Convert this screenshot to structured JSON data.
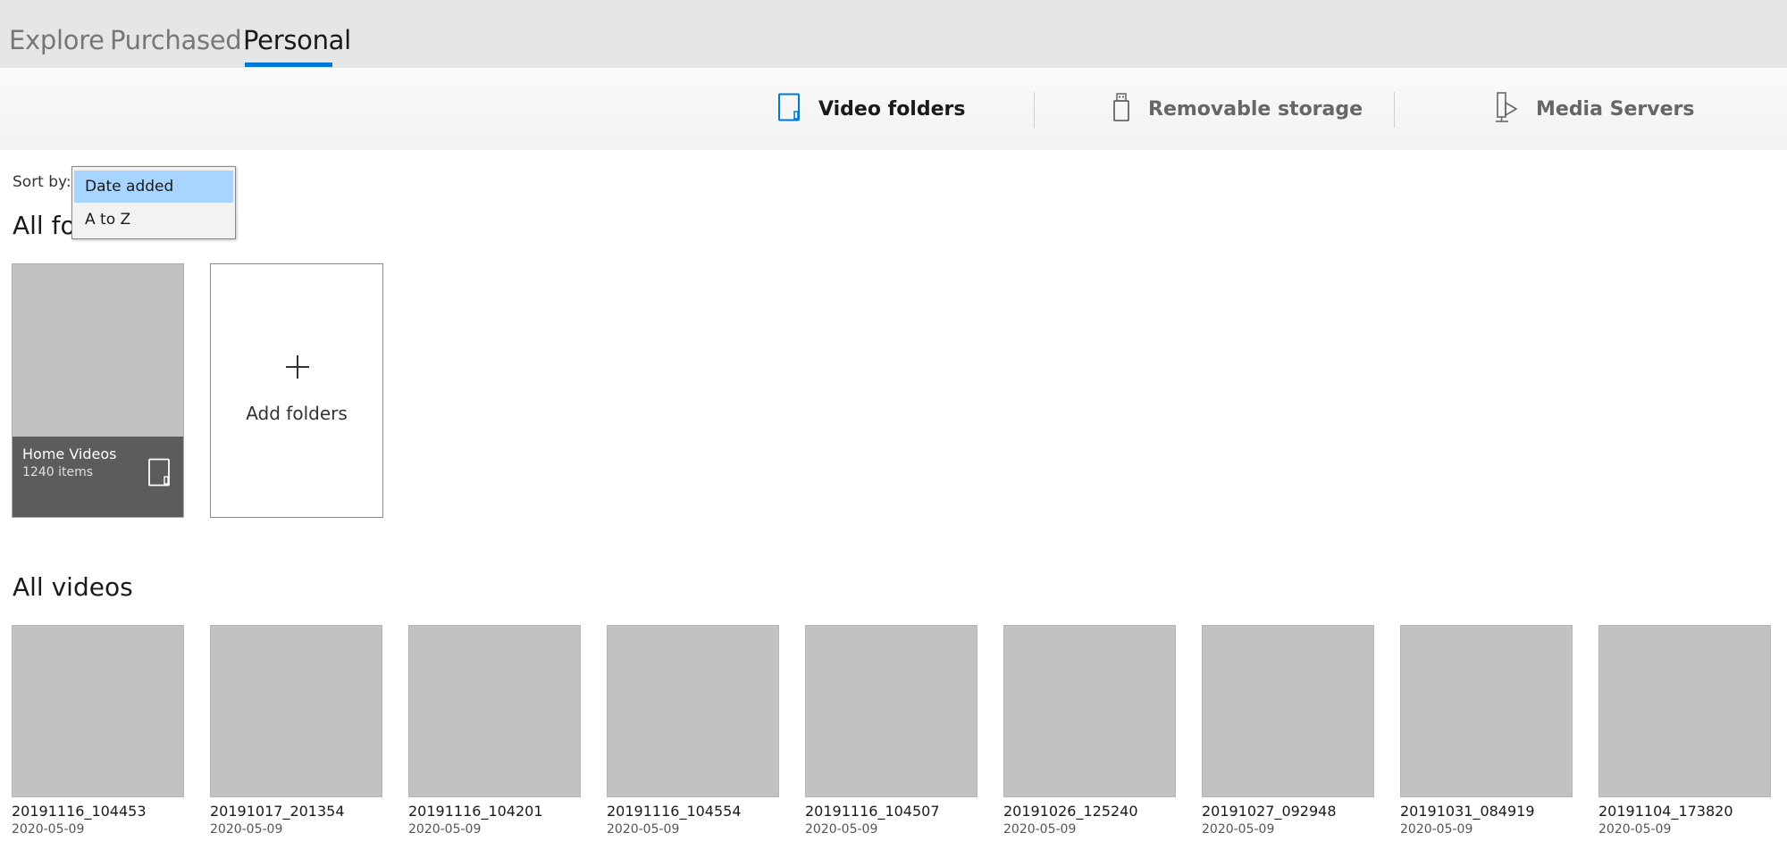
{
  "nav": {
    "tabs": [
      {
        "label": "Explore"
      },
      {
        "label": "Purchased"
      },
      {
        "label": "Personal"
      }
    ],
    "active_tab": "Personal"
  },
  "sources": [
    {
      "label": "Video folders",
      "icon": "tablet-icon"
    },
    {
      "label": "Removable storage",
      "icon": "usb-drive-icon"
    },
    {
      "label": "Media Servers",
      "icon": "media-server-icon"
    }
  ],
  "sort": {
    "label": "Sort by:",
    "options": [
      "Date added",
      "A to Z"
    ],
    "selected": "Date added"
  },
  "folders_section": {
    "title": "All fo",
    "folder": {
      "name": "Home Videos",
      "count": "1240 items"
    },
    "add_label": "Add folders"
  },
  "videos_section": {
    "title": "All videos",
    "videos": [
      {
        "name": "20191116_104453",
        "date": "2020-05-09"
      },
      {
        "name": "20191017_201354",
        "date": "2020-05-09"
      },
      {
        "name": "20191116_104201",
        "date": "2020-05-09"
      },
      {
        "name": "20191116_104554",
        "date": "2020-05-09"
      },
      {
        "name": "20191116_104507",
        "date": "2020-05-09"
      },
      {
        "name": "20191026_125240",
        "date": "2020-05-09"
      },
      {
        "name": "20191027_092948",
        "date": "2020-05-09"
      },
      {
        "name": "20191031_084919",
        "date": "2020-05-09"
      },
      {
        "name": "20191104_173820",
        "date": "2020-05-09"
      }
    ]
  },
  "colors": {
    "accent": "#0078d4",
    "selected_option": "#a8d5ff",
    "thumb": "#c2c2c2"
  }
}
